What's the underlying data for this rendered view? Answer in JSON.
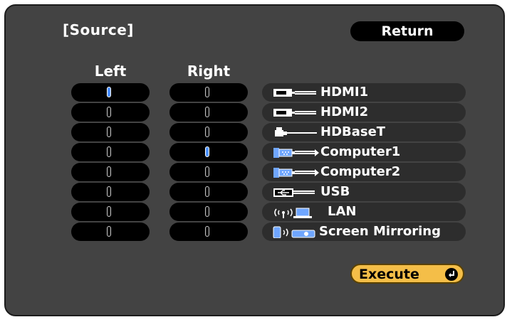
{
  "header": {
    "title": "[Source]",
    "return_label": "Return"
  },
  "columns": {
    "left_label": "Left",
    "right_label": "Right"
  },
  "sources": [
    {
      "label": "HDMI1",
      "icon": "hdmi-icon"
    },
    {
      "label": "HDMI2",
      "icon": "hdmi-icon"
    },
    {
      "label": "HDBaseT",
      "icon": "hdbaset-icon"
    },
    {
      "label": "Computer1",
      "icon": "computer-vga-icon"
    },
    {
      "label": "Computer2",
      "icon": "computer-vga-icon"
    },
    {
      "label": "USB",
      "icon": "usb-icon"
    },
    {
      "label": "LAN",
      "icon": "lan-icon"
    },
    {
      "label": "Screen Mirroring",
      "icon": "screen-mirroring-icon"
    }
  ],
  "selection": {
    "left_index": 0,
    "right_index": 3
  },
  "footer": {
    "execute_label": "Execute"
  },
  "colors": {
    "panel": "#434343",
    "selected_mark": "#4a90ff",
    "execute_button": "#f4be48"
  }
}
